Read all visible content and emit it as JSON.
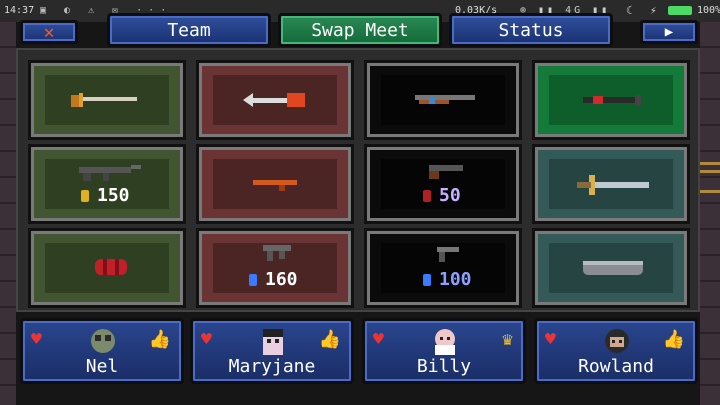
{
  "status_bar": {
    "time": "14:37",
    "left_icons": "▣ ◐ ⚠ ✉ ···",
    "network_speed": "0.03K/s",
    "signal": "⊚ ▮▮ 4G ▮▮",
    "battery": "100%"
  },
  "toolbar": {
    "close_label": "✕",
    "tabs": [
      {
        "label": "Team"
      },
      {
        "label": "Swap Meet"
      },
      {
        "label": "Status"
      }
    ],
    "next_label": "▶"
  },
  "slots": [
    {
      "item": "sword",
      "price": null
    },
    {
      "item": "arrow-launcher",
      "price": null
    },
    {
      "item": "shotgun",
      "price": null
    },
    {
      "item": "bat",
      "price": null
    },
    {
      "item": "assault-rifle",
      "price": "150",
      "currency": "gold"
    },
    {
      "item": "pistol-orange",
      "price": null
    },
    {
      "item": "shotgun-short",
      "price": "50",
      "currency": "red"
    },
    {
      "item": "broadsword",
      "price": null
    },
    {
      "item": "grenade-canister",
      "price": null
    },
    {
      "item": "submachine-gun",
      "price": "160",
      "currency": "blue"
    },
    {
      "item": "revolver",
      "price": "100",
      "currency": "blue"
    },
    {
      "item": "pipe",
      "price": null
    }
  ],
  "team": [
    {
      "name": "Nel",
      "status": "thumbs-up"
    },
    {
      "name": "Maryjane",
      "status": "thumbs-up"
    },
    {
      "name": "Billy",
      "status": "crown"
    },
    {
      "name": "Rowland",
      "status": "thumbs-up"
    }
  ],
  "colors": {
    "tab_blue": "#2f4f9c",
    "tab_green": "#2a8a55",
    "health_red": "#e33333",
    "thumb_green": "#3bd14a",
    "crown_gold": "#f2c21a"
  }
}
